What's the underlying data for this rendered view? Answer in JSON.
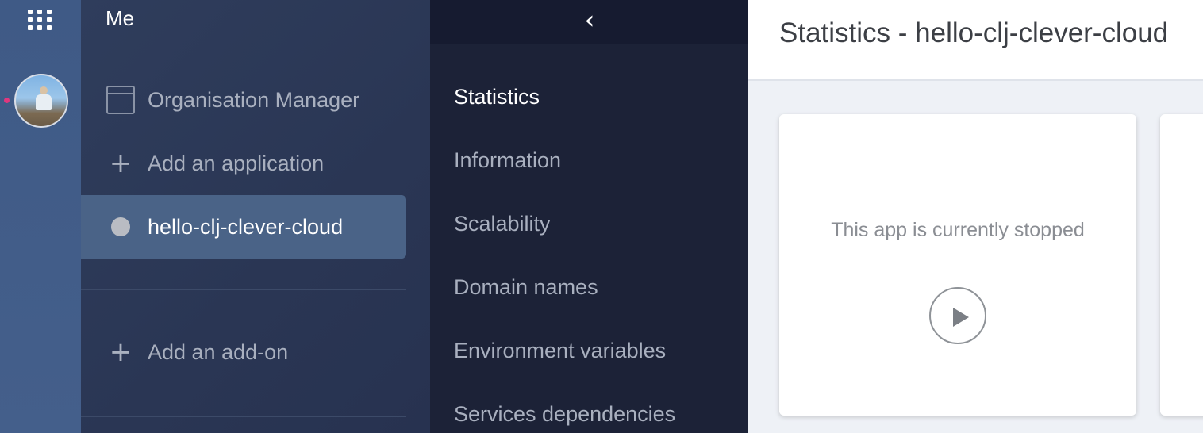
{
  "rail": {
    "apps_icon": "apps-grid-icon",
    "avatar_icon": "user-avatar"
  },
  "org_panel": {
    "title": "Me",
    "items": [
      {
        "icon": "window-icon",
        "label": "Organisation Manager"
      },
      {
        "icon": "plus-icon",
        "label": "Add an application"
      },
      {
        "icon": "status-dot-icon",
        "label": "hello-clj-clever-cloud"
      }
    ],
    "addon": {
      "icon": "plus-icon",
      "label": "Add an add-on"
    },
    "plus_glyph": "+"
  },
  "app_nav": {
    "back_glyph": "‹",
    "items": [
      {
        "label": "Statistics"
      },
      {
        "label": "Information"
      },
      {
        "label": "Scalability"
      },
      {
        "label": "Domain names"
      },
      {
        "label": "Environment variables"
      },
      {
        "label": "Services dependencies"
      }
    ]
  },
  "main": {
    "title": "Statistics - hello-clj-clever-cloud",
    "card": {
      "message": "This app is currently stopped",
      "play_icon": "play-icon"
    }
  }
}
